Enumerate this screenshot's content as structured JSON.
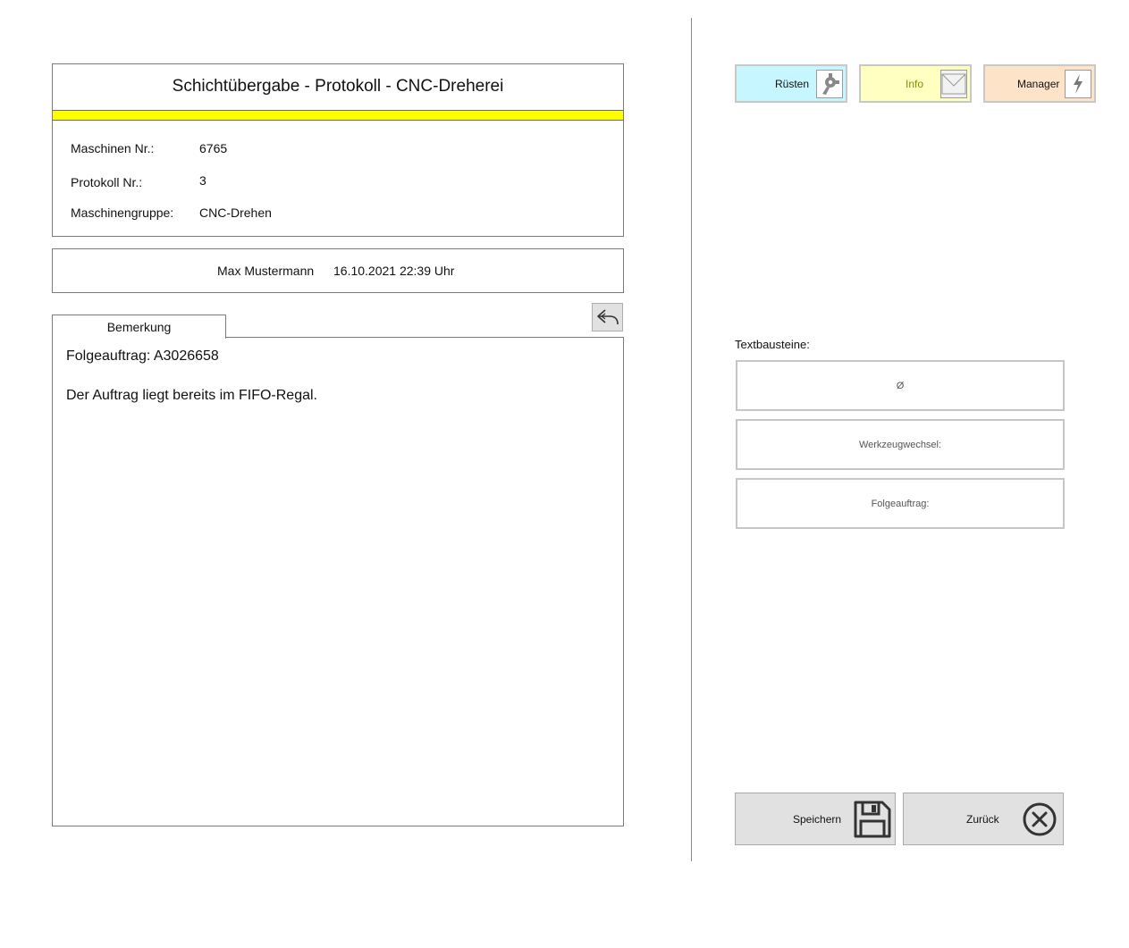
{
  "header": {
    "title": "Schichtübergabe - Protokoll - CNC-Dreherei",
    "fields": [
      {
        "label": "Maschinen Nr.:",
        "value": "6765"
      },
      {
        "label": "Protokoll Nr.:",
        "value": "3"
      },
      {
        "label": "Maschinengruppe:",
        "value": "CNC-Drehen"
      }
    ]
  },
  "user": {
    "name": "Max Mustermann",
    "datetime": "16.10.2021 22:39 Uhr"
  },
  "remark": {
    "tab_label": "Bemerkung",
    "lines": [
      "Folgeauftrag: A3026658",
      "Der Auftrag liegt bereits im FIFO-Regal."
    ]
  },
  "top_buttons": {
    "ruesten": {
      "label": "Rüsten",
      "icon": "gear-icon",
      "color": "#c6f6ff"
    },
    "info": {
      "label": "Info",
      "icon": "envelope-icon",
      "color": "#ffffc2",
      "text_color": "#8a8a00"
    },
    "manager": {
      "label": "Manager",
      "icon": "lightning-icon",
      "color": "#fde3c8"
    }
  },
  "textbausteine": {
    "label": "Textbausteine:",
    "items": [
      "Ø",
      "Werkzeugwechsel:",
      "Folgeauftrag:"
    ]
  },
  "bottom_buttons": {
    "save": {
      "label": "Speichern",
      "icon": "floppy-disk-icon"
    },
    "back": {
      "label": "Zurück",
      "icon": "close-circle-icon"
    }
  },
  "colors": {
    "accent_bar": "#ffff00",
    "button_gray": "#e1e1e1"
  }
}
